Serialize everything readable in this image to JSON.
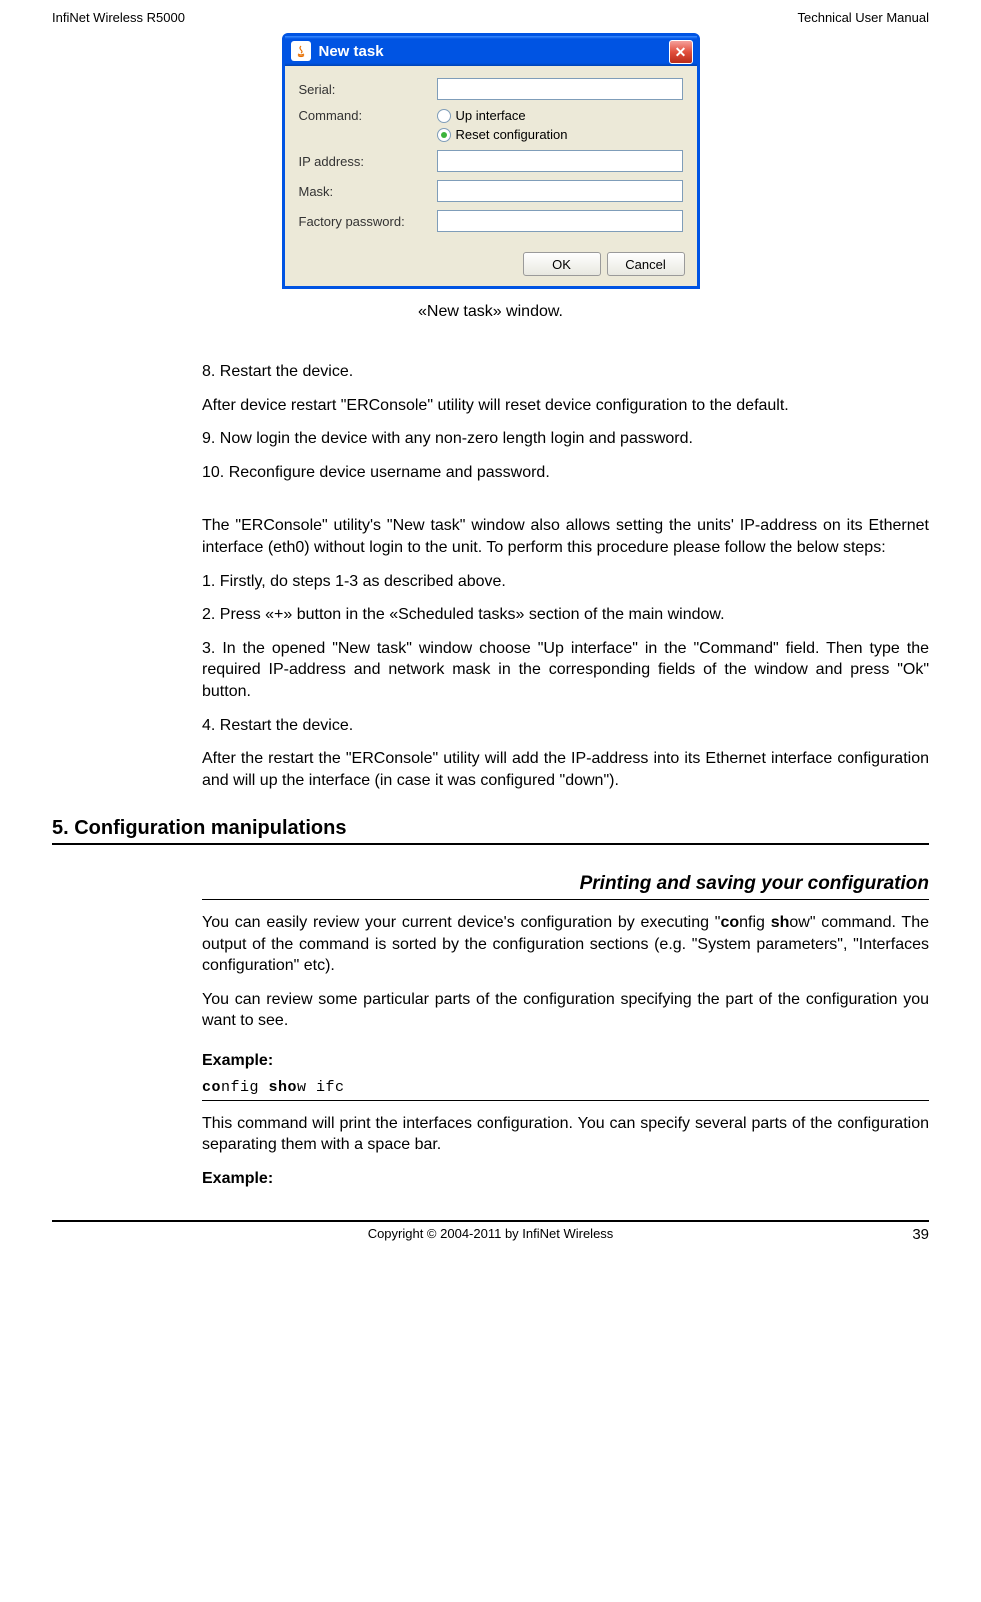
{
  "header": {
    "left": "InfiNet Wireless R5000",
    "right": "Technical User Manual"
  },
  "dialog": {
    "title": "New task",
    "labels": {
      "serial": "Serial:",
      "command": "Command:",
      "ip": "IP address:",
      "mask": "Mask:",
      "factory_pw": "Factory password:"
    },
    "radio": {
      "up": "Up interface",
      "reset": "Reset configuration"
    },
    "buttons": {
      "ok": "OK",
      "cancel": "Cancel"
    }
  },
  "caption": "«New task» window.",
  "body": {
    "p1": "8.   Restart the device.",
    "p2": "After device restart \"ERConsole\" utility will reset device configuration to the default.",
    "p3": "9.   Now login the device with any non-zero length login and password.",
    "p4": "10. Reconfigure device username and password.",
    "p5": "The \"ERConsole\" utility's \"New task\" window also allows setting the units' IP-address on its Ethernet interface (eth0) without login to the unit. To perform this procedure please follow the below steps:",
    "p6": "1. Firstly, do steps 1-3 as described above.",
    "p7": "2. Press «+» button in the «Scheduled tasks» section of the main window.",
    "p8": "3. In the opened \"New task\" window choose \"Up interface\" in the \"Command\" field. Then type the required IP-address and network mask in the corresponding fields of the window and press \"Ok\" button.",
    "p9": "4. Restart the device.",
    "p10": "After the restart the \"ERConsole\" utility will add the IP-address into its Ethernet interface configuration and will up the interface (in case it was configured \"down\").",
    "section_heading": "5. Configuration manipulations",
    "sub_heading": "Printing and saving your configuration",
    "p11a": "You can easily review your current device's configuration by executing \"",
    "p11b_bold": "co",
    "p11c": "nfig ",
    "p11d_bold": "sh",
    "p11e": "ow\" command. The output of the command is sorted by the configuration sections (e.g. \"System parameters\", \"Interfaces configuration\" etc).",
    "p12": "You can review some particular parts of the configuration specifying the part of the configuration you want to see.",
    "example_label": "Example:",
    "code1_a_bold": "co",
    "code1_b": "nfig ",
    "code1_c_bold": "sho",
    "code1_d": "w ifc",
    "p13": "This command will print the interfaces configuration. You can specify several parts of the configuration separating them with a space bar.",
    "example_label2": "Example:"
  },
  "footer": {
    "copyright": "Copyright © 2004-2011 by InfiNet Wireless",
    "page": "39"
  }
}
